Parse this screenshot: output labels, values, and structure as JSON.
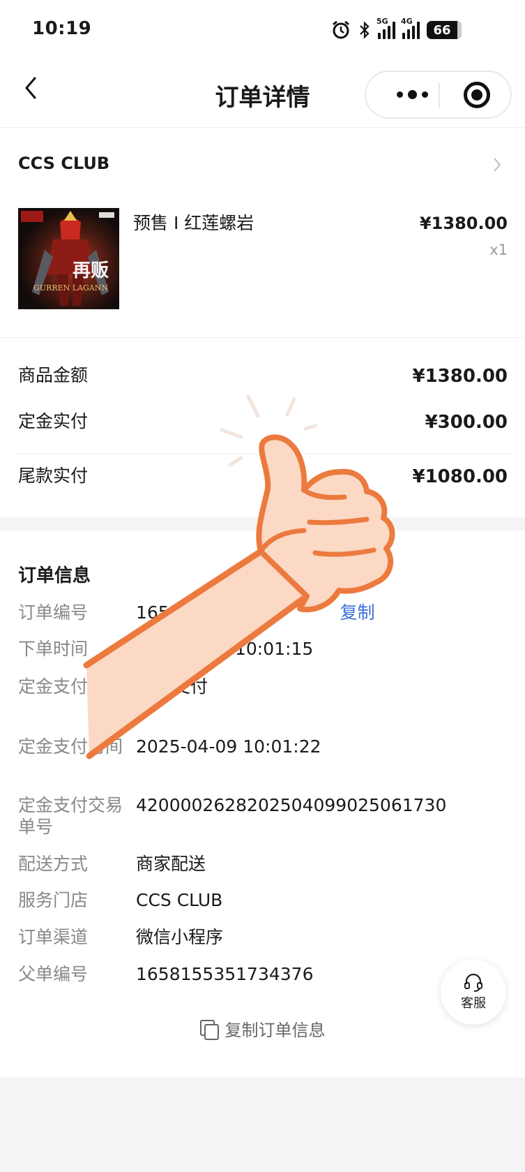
{
  "status_bar": {
    "time": "10:19",
    "battery": "66",
    "signal_1_label": "5G",
    "signal_2_label": "4G"
  },
  "nav": {
    "title": "订单详情"
  },
  "store": {
    "name": "CCS CLUB"
  },
  "product": {
    "name": "预售 I 红莲螺岩",
    "price": "¥1380.00",
    "quantity": "x1",
    "image_badge": "再贩",
    "image_caption": "GURREN LAGANN"
  },
  "amounts": [
    {
      "label": "商品金额",
      "value": "¥1380.00"
    },
    {
      "label": "定金实付",
      "value": "¥300.00"
    },
    {
      "label": "尾款实付",
      "value": "¥1080.00"
    }
  ],
  "order_info": {
    "title": "订单信息",
    "copy_label": "复制",
    "rows": [
      {
        "key": "订单编号",
        "value": "165"
      },
      {
        "key": "下单时间",
        "value": "10:01:15"
      },
      {
        "key": "定金支付方式",
        "value": "支付"
      },
      {
        "key": "定金支付时间",
        "value": "2025-04-09 10:01:22"
      },
      {
        "key": "定金支付交易单号",
        "value": "4200002628202504099025061730"
      },
      {
        "key": "配送方式",
        "value": "商家配送"
      },
      {
        "key": "服务门店",
        "value": "CCS CLUB"
      },
      {
        "key": "订单渠道",
        "value": "微信小程序"
      },
      {
        "key": "父单编号",
        "value": "1658155351734376"
      }
    ],
    "copy_all_label": "复制订单信息"
  },
  "service": {
    "label": "客服"
  },
  "colors": {
    "link": "#3a6fd8",
    "hand_outline": "#ec7a3e",
    "hand_fill": "#fbd9c5"
  }
}
